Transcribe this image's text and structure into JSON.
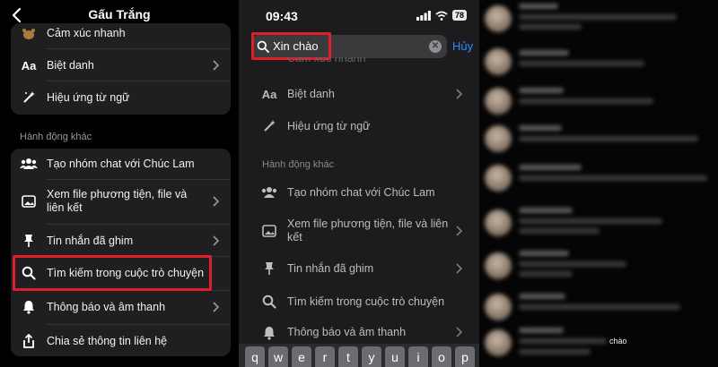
{
  "panel1": {
    "title": "Gấu Trắng",
    "rows_top": [
      {
        "label": "Cảm xúc nhanh",
        "icon": "bear-emoji-icon"
      },
      {
        "label": "Biệt danh",
        "icon": "aa-text-icon"
      },
      {
        "label": "Hiệu ứng từ ngữ",
        "icon": "magic-wand-icon"
      }
    ],
    "section_label": "Hành động khác",
    "rows_other": [
      {
        "label": "Tạo nhóm chat với Chúc Lam",
        "icon": "people-icon"
      },
      {
        "label": "Xem file phương tiện, file và liên kết",
        "icon": "image-icon"
      },
      {
        "label": "Tin nhắn đã ghim",
        "icon": "pin-icon"
      },
      {
        "label": "Tìm kiếm trong cuộc trò chuyện",
        "icon": "search-icon"
      },
      {
        "label": "Thông báo và âm thanh",
        "icon": "bell-icon"
      },
      {
        "label": "Chia sẻ thông tin liên hệ",
        "icon": "share-icon"
      }
    ]
  },
  "panel2": {
    "status": {
      "time": "09:43",
      "battery": "78"
    },
    "search": {
      "value": "Xin chào"
    },
    "cancel_label": "Hủy",
    "rows_top": [
      {
        "label": "Cảm xúc nhanh",
        "icon": "bear-emoji-icon"
      },
      {
        "label": "Biệt danh",
        "icon": "aa-text-icon"
      },
      {
        "label": "Hiệu ứng từ ngữ",
        "icon": "magic-wand-icon"
      }
    ],
    "section_label": "Hành động khác",
    "rows_other": [
      {
        "label": "Tạo nhóm chat với Chúc Lam",
        "icon": "people-icon"
      },
      {
        "label": "Xem file phương tiện, file và liên kết",
        "icon": "image-icon"
      },
      {
        "label": "Tin nhắn đã ghim",
        "icon": "pin-icon"
      },
      {
        "label": "Tìm kiếm trong cuộc trò chuyện",
        "icon": "search-icon"
      },
      {
        "label": "Thông báo và âm thanh",
        "icon": "bell-icon"
      }
    ],
    "keyboard_keys": [
      "q",
      "w",
      "e",
      "r",
      "t",
      "y",
      "u",
      "i",
      "o",
      "p"
    ]
  },
  "panel3": {
    "highlight_word": "chào"
  },
  "colors": {
    "highlight_box": "#e01e2b",
    "accent": "#2f8cff",
    "background": "#000000"
  }
}
